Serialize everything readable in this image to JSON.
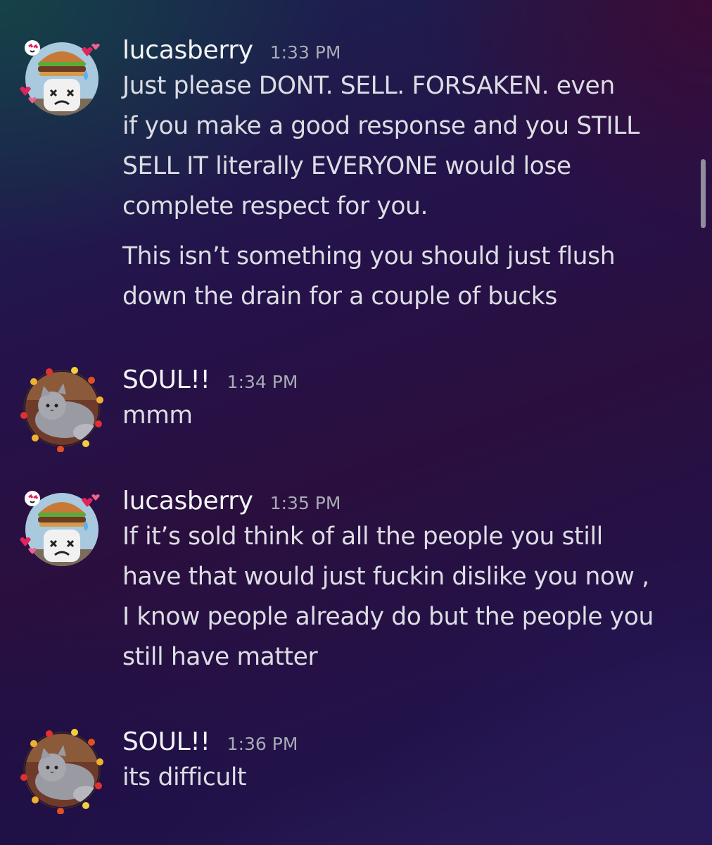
{
  "messages": [
    {
      "username": "lucasberry",
      "timestamp": "1:33 PM",
      "paragraphs": [
        [
          "Just please DONT. SELL. FORSAKEN.  even",
          "if you make a good response and you STILL",
          "SELL IT literally EVERYONE would lose",
          "complete respect for you."
        ],
        [
          "This isn’t something you should just flush",
          "down the drain for a couple of bucks"
        ]
      ]
    },
    {
      "username": "SOUL!!",
      "timestamp": "1:34 PM",
      "paragraphs": [
        [
          "mmm"
        ]
      ]
    },
    {
      "username": "lucasberry",
      "timestamp": "1:35 PM",
      "paragraphs": [
        [
          "If it’s sold think of all the people you still",
          "have that would just fuckin dislike you now ,",
          "I know people already do but the people you",
          "still have matter"
        ]
      ]
    },
    {
      "username": "SOUL!!",
      "timestamp": "1:36 PM",
      "paragraphs": [
        [
          "its difficult"
        ]
      ]
    }
  ],
  "icons": {
    "lucasberry_avatar": "avatar-burger-character-icon",
    "soul_avatar": "avatar-gray-cat-string-lights-icon",
    "scrollbar": "scrollbar-thumb"
  }
}
